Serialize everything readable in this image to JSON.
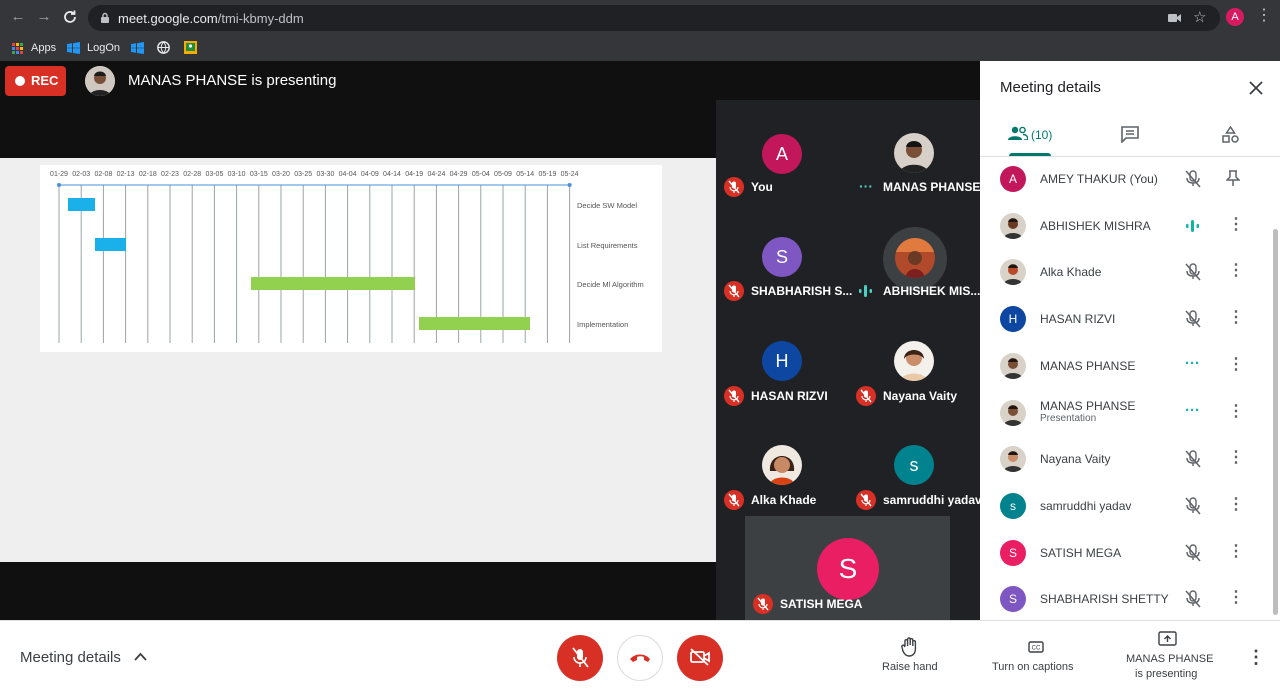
{
  "browser": {
    "url_host": "meet.google.com",
    "url_path": "/tmi-kbmy-ddm",
    "profile_initial": "A",
    "bookmarks": [
      "Apps",
      "LogOn"
    ]
  },
  "meeting": {
    "rec_label": "REC",
    "presenting_text": "MANAS PHANSE is presenting"
  },
  "gantt": {
    "dates": [
      "01-29",
      "02-03",
      "02-08",
      "02-13",
      "02-18",
      "02-23",
      "02-28",
      "03-05",
      "03-10",
      "03-15",
      "03-20",
      "03-25",
      "03-30",
      "04-04",
      "04-09",
      "04-14",
      "04-19",
      "04-24",
      "04-29",
      "05-04",
      "05-09",
      "05-14",
      "05-19",
      "05-24"
    ],
    "tasks": [
      "Decide SW Model",
      "List Requirements",
      "Decide Ml Algorithm",
      "Implementation"
    ]
  },
  "tiles": [
    {
      "name": "You",
      "initial": "A",
      "color": "#c2185b",
      "status": "muted"
    },
    {
      "name": "MANAS PHANSE",
      "status": "dots"
    },
    {
      "name": "SHABHARISH S...",
      "initial": "S",
      "color": "#7e57c2",
      "status": "muted"
    },
    {
      "name": "ABHISHEK MIS...",
      "status": "speaking"
    },
    {
      "name": "HASAN RIZVI",
      "initial": "H",
      "color": "#0d47a1",
      "status": "muted"
    },
    {
      "name": "Nayana Vaity",
      "status": "muted"
    },
    {
      "name": "Alka Khade",
      "status": "muted"
    },
    {
      "name": "samruddhi yadav",
      "initial": "s",
      "color": "#00838f",
      "status": "muted"
    },
    {
      "name": "SATISH MEGA",
      "initial": "S",
      "color": "#e91e63",
      "status": "muted"
    }
  ],
  "panel": {
    "title": "Meeting details",
    "people_count": "(10)",
    "people": [
      {
        "name": "AMEY THAKUR (You)",
        "initial": "A",
        "color": "#c2185b",
        "status": "muted",
        "action": "pin"
      },
      {
        "name": "ABHISHEK MISHRA",
        "status": "speaking",
        "action": "more"
      },
      {
        "name": "Alka Khade",
        "status": "muted",
        "action": "more"
      },
      {
        "name": "HASAN RIZVI",
        "initial": "H",
        "color": "#0d47a1",
        "status": "muted",
        "action": "more"
      },
      {
        "name": "MANAS PHANSE",
        "status": "dots",
        "action": "more"
      },
      {
        "name": "MANAS PHANSE",
        "subtitle": "Presentation",
        "status": "dots",
        "action": "more"
      },
      {
        "name": "Nayana Vaity",
        "status": "muted",
        "action": "more"
      },
      {
        "name": "samruddhi yadav",
        "initial": "s",
        "color": "#00838f",
        "status": "muted",
        "action": "more"
      },
      {
        "name": "SATISH MEGA",
        "initial": "S",
        "color": "#e91e63",
        "status": "muted",
        "action": "more"
      },
      {
        "name": "SHABHARISH SHETTY",
        "initial": "S",
        "color": "#7e57c2",
        "status": "muted",
        "action": "more"
      }
    ]
  },
  "bottom": {
    "meeting_details": "Meeting details",
    "raise_hand": "Raise hand",
    "captions": "Turn on captions",
    "presenting_line1": "MANAS PHANSE",
    "presenting_line2": "is presenting"
  },
  "colors": {
    "mute_red": "#d93025",
    "teal": "#00897b",
    "gantt_blue": "#1ab0ea",
    "gantt_green": "#92d050"
  }
}
